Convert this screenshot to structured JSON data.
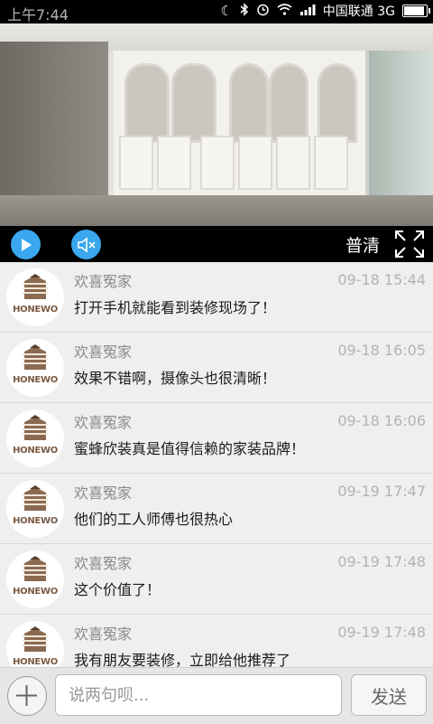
{
  "status_bar": {
    "time": "上午7:44",
    "carrier": "中国联通 3G"
  },
  "player": {
    "quality_label": "普清",
    "accent_color": "#3aa7ef"
  },
  "comments": [
    {
      "author": "欢喜冤家",
      "time": "09-18 15:44",
      "message": "打开手机就能看到装修现场了！",
      "avatar_text": "HONEWO"
    },
    {
      "author": "欢喜冤家",
      "time": "09-18 16:05",
      "message": "效果不错啊，摄像头也很清晰！",
      "avatar_text": "HONEWO"
    },
    {
      "author": "欢喜冤家",
      "time": "09-18 16:06",
      "message": "蜜蜂欣装真是值得信赖的家装品牌！",
      "avatar_text": "HONEWO"
    },
    {
      "author": "欢喜冤家",
      "time": "09-19 17:47",
      "message": "他们的工人师傅也很热心",
      "avatar_text": "HONEWO"
    },
    {
      "author": "欢喜冤家",
      "time": "09-19 17:48",
      "message": "这个价值了！",
      "avatar_text": "HONEWO"
    },
    {
      "author": "欢喜冤家",
      "time": "09-19 17:48",
      "message": "我有朋友要装修，立即给他推荐了",
      "avatar_text": "HONEWO"
    }
  ],
  "input_bar": {
    "placeholder": "说两句呗...",
    "send_label": "发送"
  }
}
